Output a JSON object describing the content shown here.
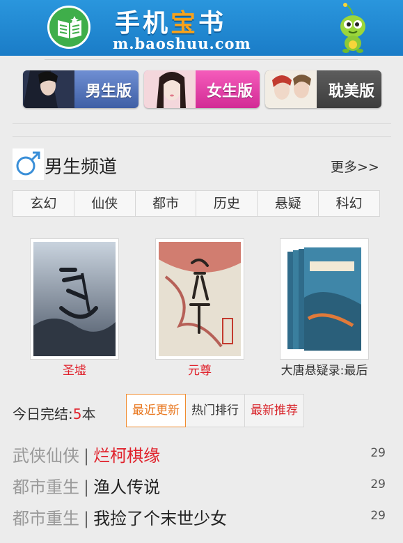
{
  "header": {
    "title_part1": "手机",
    "title_part2": "宝",
    "title_part3": "书",
    "domain": "m.baoshuu.com"
  },
  "versions": [
    {
      "label": "男生版"
    },
    {
      "label": "女生版"
    },
    {
      "label": "耽美版"
    }
  ],
  "male_channel": {
    "title": "男生频道",
    "more": "更多>>",
    "genres": [
      "玄幻",
      "仙侠",
      "都市",
      "历史",
      "悬疑",
      "科幻"
    ],
    "books": [
      {
        "title": "圣墟",
        "color": "#e0212b"
      },
      {
        "title": "元尊",
        "color": "#e0212b"
      },
      {
        "title": "大唐悬疑录:最后",
        "color": "#333333"
      }
    ]
  },
  "today": {
    "label": "今日完结:",
    "count": "5",
    "unit": "本"
  },
  "tabs": [
    {
      "label": "最近更新",
      "state": "active"
    },
    {
      "label": "热门排行",
      "state": "normal"
    },
    {
      "label": "最新推荐",
      "state": "red"
    }
  ],
  "list": [
    {
      "category": "武侠仙侠",
      "name": "烂柯棋缘",
      "count": "29"
    },
    {
      "category": "都市重生",
      "name": "渔人传说",
      "count": "29"
    },
    {
      "category": "都市重生",
      "name": "我捡了个末世少女",
      "count": "29"
    }
  ],
  "colors": {
    "header_blue": "#1a7cc7",
    "accent_red": "#e0212b",
    "active_orange": "#e8761d"
  }
}
